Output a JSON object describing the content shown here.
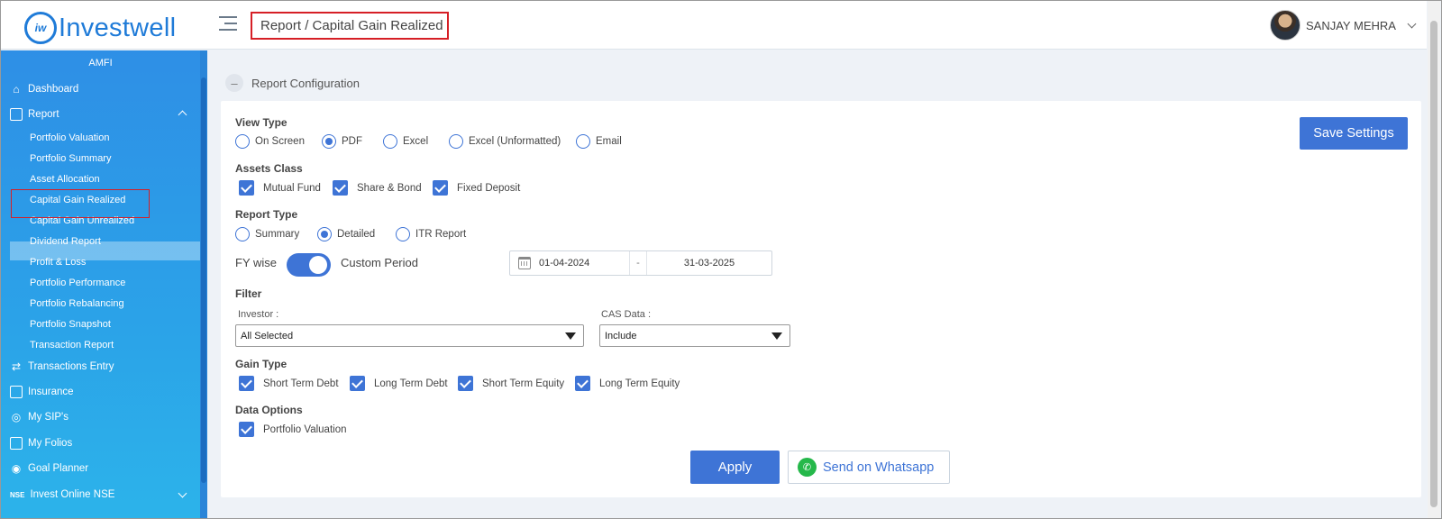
{
  "header": {
    "logo_mark": "iw",
    "logo_text": "Investwell",
    "breadcrumb": "Report / Capital Gain Realized",
    "user_name": "SANJAY MEHRA"
  },
  "sidebar": {
    "org": "AMFI",
    "dashboard": "Dashboard",
    "report": "Report",
    "report_items": [
      "Portfolio Valuation",
      "Portfolio Summary",
      "Asset Allocation",
      "Capital Gain Realized",
      "Capital Gain Unrealized",
      "Dividend Report",
      "Profit & Loss",
      "Portfolio Performance",
      "Portfolio Rebalancing",
      "Portfolio Snapshot",
      "Transaction Report"
    ],
    "active_item": "Capital Gain Realized",
    "transactions_entry": "Transactions Entry",
    "insurance": "Insurance",
    "my_sips": "My SIP's",
    "my_folios": "My Folios",
    "goal_planner": "Goal Planner",
    "nse_badge": "NSE",
    "invest_online": "Invest Online NSE"
  },
  "config": {
    "title": "Report Configuration",
    "collapse_symbol": "–",
    "save_label": "Save Settings",
    "view_type": {
      "label": "View Type",
      "options": [
        "On Screen",
        "PDF",
        "Excel",
        "Excel (Unformatted)",
        "Email"
      ],
      "selected": "PDF"
    },
    "assets_class": {
      "label": "Assets Class",
      "options": [
        "Mutual Fund",
        "Share & Bond",
        "Fixed Deposit"
      ],
      "checked": [
        "Mutual Fund",
        "Share & Bond",
        "Fixed Deposit"
      ]
    },
    "report_type": {
      "label": "Report Type",
      "options": [
        "Summary",
        "Detailed",
        "ITR Report"
      ],
      "selected": "Detailed"
    },
    "period": {
      "fy_label": "FY wise",
      "custom_label": "Custom Period",
      "toggle_on": true,
      "from": "01-04-2024",
      "separator": "-",
      "to": "31-03-2025"
    },
    "filter": {
      "label": "Filter",
      "investor_label": "Investor :",
      "investor_value": "All Selected",
      "cas_label": "CAS Data :",
      "cas_value": "Include"
    },
    "gain_type": {
      "label": "Gain Type",
      "options": [
        "Short Term Debt",
        "Long Term Debt",
        "Short Term Equity",
        "Long Term Equity"
      ],
      "checked": [
        "Short Term Debt",
        "Long Term Debt",
        "Short Term Equity",
        "Long Term Equity"
      ]
    },
    "data_options": {
      "label": "Data Options",
      "options": [
        "Portfolio Valuation"
      ],
      "checked": [
        "Portfolio Valuation"
      ]
    },
    "apply_label": "Apply",
    "whatsapp_label": "Send on Whatsapp"
  },
  "colors": {
    "accent": "#3e74d6",
    "sidebar": "#2e8fe6",
    "highlight_border": "#d61f26",
    "whatsapp": "#25b84a"
  }
}
